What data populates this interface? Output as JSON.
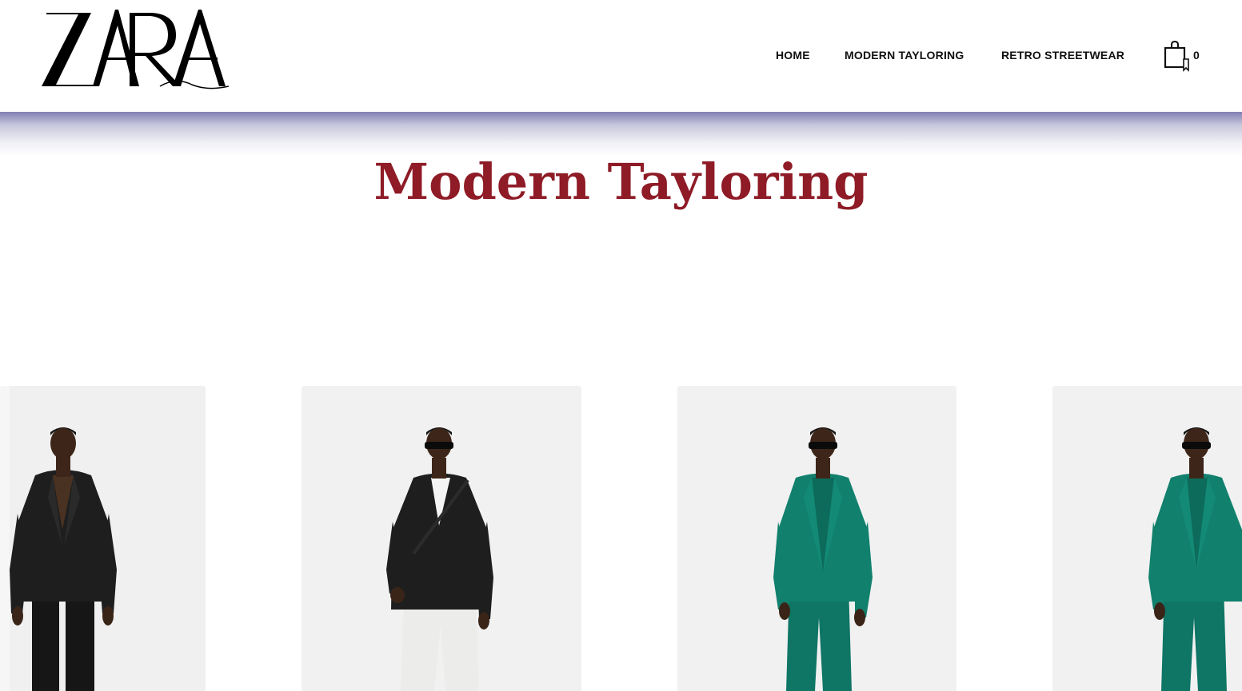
{
  "brand": {
    "logo_text": "ZARA"
  },
  "nav": {
    "items": [
      {
        "label": "HOME"
      },
      {
        "label": "MODERN TAYLORING"
      },
      {
        "label": "RETRO STREETWEAR"
      }
    ]
  },
  "cart": {
    "count": "0",
    "icon": "shopping-bag-icon"
  },
  "page": {
    "title": "Modern Tayloring"
  },
  "colors": {
    "title": "#8e1b26",
    "band_top": "#7f7fb2",
    "black_suit": "#1e1e1e",
    "green_suit": "#0f7565",
    "white_trousers": "#ececea"
  },
  "products": [
    {
      "suit_color": "black",
      "trousers_color": "black",
      "sunglasses": false
    },
    {
      "suit_color": "black",
      "trousers_color": "white",
      "sunglasses": true
    },
    {
      "suit_color": "green",
      "trousers_color": "green",
      "sunglasses": true
    },
    {
      "suit_color": "green",
      "trousers_color": "green",
      "sunglasses": true
    }
  ]
}
